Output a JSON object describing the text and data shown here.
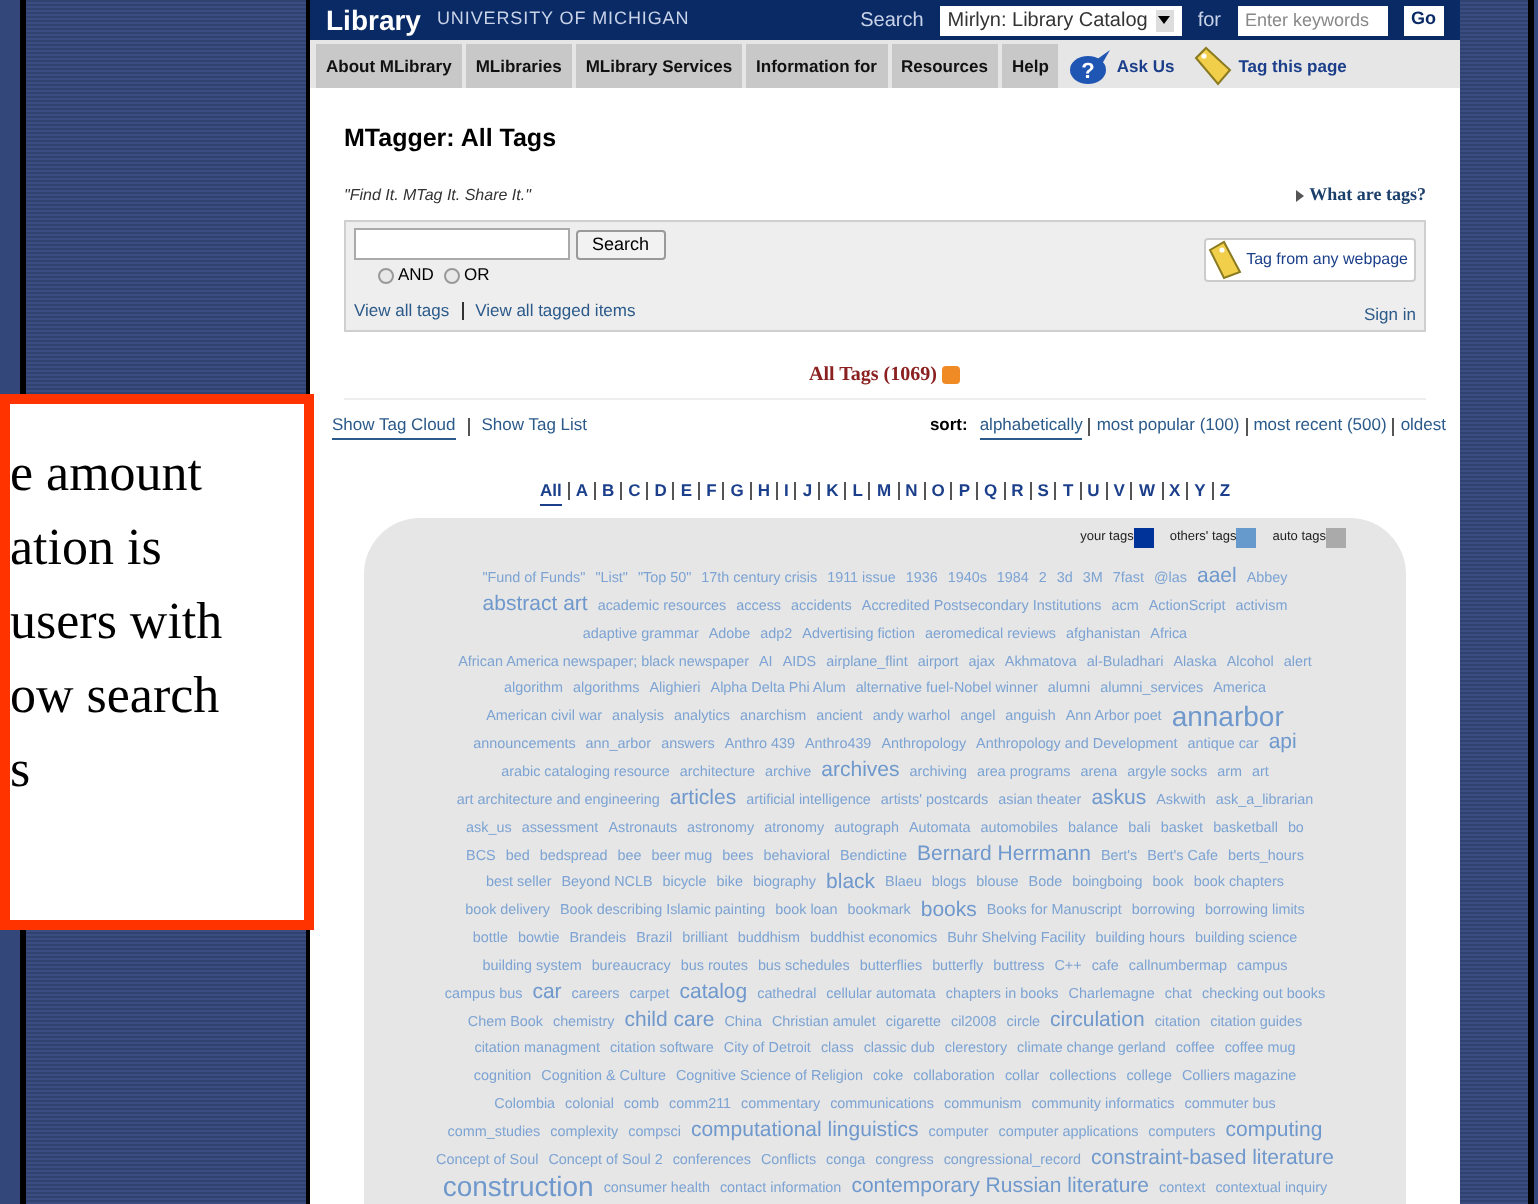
{
  "header": {
    "logo": "Library",
    "university": "UNIVERSITY OF MICHIGAN",
    "search_label": "Search",
    "catalog_select": "Mirlyn: Library Catalog",
    "for_label": "for",
    "keyword_placeholder": "Enter keywords",
    "go_button": "Go"
  },
  "nav": [
    {
      "label": "About MLibrary",
      "kind": "tab"
    },
    {
      "label": "MLibraries",
      "kind": "tab"
    },
    {
      "label": "MLibrary Services",
      "kind": "tab"
    },
    {
      "label": "Information for",
      "kind": "tab"
    },
    {
      "label": "Resources",
      "kind": "tab"
    },
    {
      "label": "Help",
      "kind": "tab"
    },
    {
      "label": "Ask Us",
      "kind": "ask",
      "icon_text": "?"
    },
    {
      "label": "Tag this page",
      "kind": "tag"
    }
  ],
  "page_title": "MTagger: All Tags",
  "tagline": "\"Find It. MTag It. Share It.\"",
  "what_are_tags": "What are tags?",
  "search": {
    "button": "Search",
    "options": [
      {
        "label": "AND",
        "selected": false
      },
      {
        "label": "OR",
        "selected": false
      }
    ],
    "links": [
      "View all tags",
      "View all tagged items"
    ],
    "sign_in": "Sign in",
    "tag_button": "Tag from any webpage"
  },
  "all_tags_heading": "All Tags (1069)",
  "view_links": [
    {
      "label": "Show Tag Cloud",
      "selected": true
    },
    {
      "label": "Show Tag List",
      "selected": false
    }
  ],
  "sort_label": "sort:",
  "sort_options": [
    {
      "label": "alphabetically",
      "selected": true
    },
    {
      "label": "most popular (100)",
      "selected": false
    },
    {
      "label": "most recent (500)",
      "selected": false
    },
    {
      "label": "oldest",
      "selected": false
    }
  ],
  "letters": [
    {
      "label": "All",
      "selected": true
    },
    {
      "label": "A",
      "selected": false
    },
    {
      "label": "B",
      "selected": false
    },
    {
      "label": "C",
      "selected": false
    },
    {
      "label": "D",
      "selected": false
    },
    {
      "label": "E",
      "selected": false
    },
    {
      "label": "F",
      "selected": false
    },
    {
      "label": "G",
      "selected": false
    },
    {
      "label": "H",
      "selected": false
    },
    {
      "label": "I",
      "selected": false
    },
    {
      "label": "J",
      "selected": false
    },
    {
      "label": "K",
      "selected": false
    },
    {
      "label": "L",
      "selected": false
    },
    {
      "label": "M",
      "selected": false
    },
    {
      "label": "N",
      "selected": false
    },
    {
      "label": "O",
      "selected": false
    },
    {
      "label": "P",
      "selected": false
    },
    {
      "label": "Q",
      "selected": false
    },
    {
      "label": "R",
      "selected": false
    },
    {
      "label": "S",
      "selected": false
    },
    {
      "label": "T",
      "selected": false
    },
    {
      "label": "U",
      "selected": false
    },
    {
      "label": "V",
      "selected": false
    },
    {
      "label": "W",
      "selected": false
    },
    {
      "label": "X",
      "selected": false
    },
    {
      "label": "Y",
      "selected": false
    },
    {
      "label": "Z",
      "selected": false
    }
  ],
  "legend": [
    {
      "label": "your tags",
      "color": "#003399"
    },
    {
      "label": "others' tags",
      "color": "#6699cc"
    },
    {
      "label": "auto tags",
      "color": "#aaaaaa"
    }
  ],
  "tag_rows": [
    [
      {
        "text": "\"Fund of Funds\"",
        "kind": "small"
      },
      {
        "text": "\"List\"",
        "kind": "small"
      },
      {
        "text": "\"Top 50\"",
        "kind": "small"
      },
      {
        "text": "17th century crisis",
        "kind": "small"
      },
      {
        "text": "1911 issue",
        "kind": "small"
      },
      {
        "text": "1936",
        "kind": "small"
      },
      {
        "text": "1940s",
        "kind": "small"
      },
      {
        "text": "1984",
        "kind": "small"
      },
      {
        "text": "2",
        "kind": "small"
      },
      {
        "text": "3d",
        "kind": "small"
      },
      {
        "text": "3M",
        "kind": "small"
      },
      {
        "text": "7fast",
        "kind": "small"
      },
      {
        "text": "@las",
        "kind": "small"
      },
      {
        "text": "aael",
        "kind": "medium"
      },
      {
        "text": "Abbey",
        "kind": "small"
      }
    ],
    [
      {
        "text": "abstract art",
        "kind": "medium"
      },
      {
        "text": "academic resources",
        "kind": "small"
      },
      {
        "text": "access",
        "kind": "small"
      },
      {
        "text": "accidents",
        "kind": "small"
      },
      {
        "text": "Accredited Postsecondary Institutions",
        "kind": "small"
      },
      {
        "text": "acm",
        "kind": "small"
      },
      {
        "text": "ActionScript",
        "kind": "small"
      },
      {
        "text": "activism",
        "kind": "small"
      }
    ],
    [
      {
        "text": "adaptive grammar",
        "kind": "small"
      },
      {
        "text": "Adobe",
        "kind": "small"
      },
      {
        "text": "adp2",
        "kind": "small"
      },
      {
        "text": "Advertising fiction",
        "kind": "small"
      },
      {
        "text": "aeromedical reviews",
        "kind": "small"
      },
      {
        "text": "afghanistan",
        "kind": "small"
      },
      {
        "text": "Africa",
        "kind": "small"
      }
    ],
    [
      {
        "text": "African America newspaper; black newspaper",
        "kind": "small"
      },
      {
        "text": "AI",
        "kind": "small"
      },
      {
        "text": "AIDS",
        "kind": "small"
      },
      {
        "text": "airplane_flint",
        "kind": "small"
      },
      {
        "text": "airport",
        "kind": "small"
      },
      {
        "text": "ajax",
        "kind": "small"
      },
      {
        "text": "Akhmatova",
        "kind": "small"
      },
      {
        "text": "al-Buladhari",
        "kind": "small"
      },
      {
        "text": "Alaska",
        "kind": "small"
      },
      {
        "text": "Alcohol",
        "kind": "small"
      },
      {
        "text": "alert",
        "kind": "small"
      }
    ],
    [
      {
        "text": "algorithm",
        "kind": "small"
      },
      {
        "text": "algorithms",
        "kind": "small"
      },
      {
        "text": "Alighieri",
        "kind": "small"
      },
      {
        "text": "Alpha Delta Phi Alum",
        "kind": "small"
      },
      {
        "text": "alternative fuel-Nobel winner",
        "kind": "small"
      },
      {
        "text": "alumni",
        "kind": "small"
      },
      {
        "text": "alumni_services",
        "kind": "small"
      },
      {
        "text": "America",
        "kind": "small"
      }
    ],
    [
      {
        "text": "American civil war",
        "kind": "small"
      },
      {
        "text": "analysis",
        "kind": "small"
      },
      {
        "text": "analytics",
        "kind": "small"
      },
      {
        "text": "anarchism",
        "kind": "small"
      },
      {
        "text": "ancient",
        "kind": "small"
      },
      {
        "text": "andy warhol",
        "kind": "small"
      },
      {
        "text": "angel",
        "kind": "small"
      },
      {
        "text": "anguish",
        "kind": "small"
      },
      {
        "text": "Ann Arbor poet",
        "kind": "small"
      },
      {
        "text": "annarbor",
        "kind": "large"
      }
    ],
    [
      {
        "text": "announcements",
        "kind": "small"
      },
      {
        "text": "ann_arbor",
        "kind": "small"
      },
      {
        "text": "answers",
        "kind": "small"
      },
      {
        "text": "Anthro 439",
        "kind": "small"
      },
      {
        "text": "Anthro439",
        "kind": "small"
      },
      {
        "text": "Anthropology",
        "kind": "small"
      },
      {
        "text": "Anthropology and Development",
        "kind": "small"
      },
      {
        "text": "antique car",
        "kind": "small"
      },
      {
        "text": "api",
        "kind": "medium"
      }
    ],
    [
      {
        "text": "arabic cataloging resource",
        "kind": "small"
      },
      {
        "text": "architecture",
        "kind": "small"
      },
      {
        "text": "archive",
        "kind": "small"
      },
      {
        "text": "archives",
        "kind": "medium"
      },
      {
        "text": "archiving",
        "kind": "small"
      },
      {
        "text": "area programs",
        "kind": "small"
      },
      {
        "text": "arena",
        "kind": "small"
      },
      {
        "text": "argyle socks",
        "kind": "small"
      },
      {
        "text": "arm",
        "kind": "small"
      },
      {
        "text": "art",
        "kind": "small"
      }
    ],
    [
      {
        "text": "art architecture and engineering",
        "kind": "small"
      },
      {
        "text": "articles",
        "kind": "medium"
      },
      {
        "text": "artificial intelligence",
        "kind": "small"
      },
      {
        "text": "artists' postcards",
        "kind": "small"
      },
      {
        "text": "asian theater",
        "kind": "small"
      },
      {
        "text": "askus",
        "kind": "medium"
      },
      {
        "text": "Askwith",
        "kind": "small"
      },
      {
        "text": "ask_a_librarian",
        "kind": "small"
      }
    ],
    [
      {
        "text": "ask_us",
        "kind": "small"
      },
      {
        "text": "assessment",
        "kind": "small"
      },
      {
        "text": "Astronauts",
        "kind": "small"
      },
      {
        "text": "astronomy",
        "kind": "small"
      },
      {
        "text": "atronomy",
        "kind": "small"
      },
      {
        "text": "autograph",
        "kind": "small"
      },
      {
        "text": "Automata",
        "kind": "small"
      },
      {
        "text": "automobiles",
        "kind": "small"
      },
      {
        "text": "balance",
        "kind": "small"
      },
      {
        "text": "bali",
        "kind": "small"
      },
      {
        "text": "basket",
        "kind": "small"
      },
      {
        "text": "basketball",
        "kind": "small"
      },
      {
        "text": "bo",
        "kind": "small"
      }
    ],
    [
      {
        "text": "BCS",
        "kind": "small"
      },
      {
        "text": "bed",
        "kind": "small"
      },
      {
        "text": "bedspread",
        "kind": "small"
      },
      {
        "text": "bee",
        "kind": "small"
      },
      {
        "text": "beer mug",
        "kind": "small"
      },
      {
        "text": "bees",
        "kind": "small"
      },
      {
        "text": "behavioral",
        "kind": "small"
      },
      {
        "text": "Bendictine",
        "kind": "small"
      },
      {
        "text": "Bernard Herrmann",
        "kind": "medium"
      },
      {
        "text": "Bert's",
        "kind": "small"
      },
      {
        "text": "Bert's Cafe",
        "kind": "small"
      },
      {
        "text": "berts_hours",
        "kind": "small"
      }
    ],
    [
      {
        "text": "best seller",
        "kind": "small"
      },
      {
        "text": "Beyond NCLB",
        "kind": "small"
      },
      {
        "text": "bicycle",
        "kind": "small"
      },
      {
        "text": "bike",
        "kind": "small"
      },
      {
        "text": "biography",
        "kind": "small"
      },
      {
        "text": "black",
        "kind": "medium"
      },
      {
        "text": "Blaeu",
        "kind": "small"
      },
      {
        "text": "blogs",
        "kind": "small"
      },
      {
        "text": "blouse",
        "kind": "small"
      },
      {
        "text": "Bode",
        "kind": "small"
      },
      {
        "text": "boingboing",
        "kind": "small"
      },
      {
        "text": "book",
        "kind": "small"
      },
      {
        "text": "book chapters",
        "kind": "small"
      }
    ],
    [
      {
        "text": "book delivery",
        "kind": "small"
      },
      {
        "text": "Book describing Islamic painting",
        "kind": "small"
      },
      {
        "text": "book loan",
        "kind": "small"
      },
      {
        "text": "bookmark",
        "kind": "small"
      },
      {
        "text": "books",
        "kind": "medium"
      },
      {
        "text": "Books for Manuscript",
        "kind": "small"
      },
      {
        "text": "borrowing",
        "kind": "small"
      },
      {
        "text": "borrowing limits",
        "kind": "small"
      }
    ],
    [
      {
        "text": "bottle",
        "kind": "small"
      },
      {
        "text": "bowtie",
        "kind": "small"
      },
      {
        "text": "Brandeis",
        "kind": "small"
      },
      {
        "text": "Brazil",
        "kind": "small"
      },
      {
        "text": "brilliant",
        "kind": "small"
      },
      {
        "text": "buddhism",
        "kind": "small"
      },
      {
        "text": "buddhist economics",
        "kind": "small"
      },
      {
        "text": "Buhr Shelving Facility",
        "kind": "small"
      },
      {
        "text": "building hours",
        "kind": "small"
      },
      {
        "text": "building science",
        "kind": "small"
      }
    ],
    [
      {
        "text": "building system",
        "kind": "small"
      },
      {
        "text": "bureaucracy",
        "kind": "small"
      },
      {
        "text": "bus routes",
        "kind": "small"
      },
      {
        "text": "bus schedules",
        "kind": "small"
      },
      {
        "text": "butterflies",
        "kind": "small"
      },
      {
        "text": "butterfly",
        "kind": "small"
      },
      {
        "text": "buttress",
        "kind": "small"
      },
      {
        "text": "C++",
        "kind": "small"
      },
      {
        "text": "cafe",
        "kind": "small"
      },
      {
        "text": "callnumbermap",
        "kind": "small"
      },
      {
        "text": "campus",
        "kind": "small"
      }
    ],
    [
      {
        "text": "campus bus",
        "kind": "small"
      },
      {
        "text": "car",
        "kind": "medium"
      },
      {
        "text": "careers",
        "kind": "small"
      },
      {
        "text": "carpet",
        "kind": "small"
      },
      {
        "text": "catalog",
        "kind": "medium"
      },
      {
        "text": "cathedral",
        "kind": "small"
      },
      {
        "text": "cellular automata",
        "kind": "small"
      },
      {
        "text": "chapters in books",
        "kind": "small"
      },
      {
        "text": "Charlemagne",
        "kind": "small"
      },
      {
        "text": "chat",
        "kind": "small"
      },
      {
        "text": "checking out books",
        "kind": "small"
      }
    ],
    [
      {
        "text": "Chem Book",
        "kind": "small"
      },
      {
        "text": "chemistry",
        "kind": "small"
      },
      {
        "text": "child care",
        "kind": "medium"
      },
      {
        "text": "China",
        "kind": "small"
      },
      {
        "text": "Christian amulet",
        "kind": "small"
      },
      {
        "text": "cigarette",
        "kind": "small"
      },
      {
        "text": "cil2008",
        "kind": "small"
      },
      {
        "text": "circle",
        "kind": "small"
      },
      {
        "text": "circulation",
        "kind": "medium"
      },
      {
        "text": "citation",
        "kind": "small"
      },
      {
        "text": "citation guides",
        "kind": "small"
      }
    ],
    [
      {
        "text": "citation managment",
        "kind": "small"
      },
      {
        "text": "citation software",
        "kind": "small"
      },
      {
        "text": "City of Detroit",
        "kind": "small"
      },
      {
        "text": "class",
        "kind": "small"
      },
      {
        "text": "classic dub",
        "kind": "small"
      },
      {
        "text": "clerestory",
        "kind": "small"
      },
      {
        "text": "climate change gerland",
        "kind": "small"
      },
      {
        "text": "coffee",
        "kind": "small"
      },
      {
        "text": "coffee mug",
        "kind": "small"
      }
    ],
    [
      {
        "text": "cognition",
        "kind": "small"
      },
      {
        "text": "Cognition & Culture",
        "kind": "small"
      },
      {
        "text": "Cognitive Science of Religion",
        "kind": "small"
      },
      {
        "text": "coke",
        "kind": "small"
      },
      {
        "text": "collaboration",
        "kind": "small"
      },
      {
        "text": "collar",
        "kind": "small"
      },
      {
        "text": "collections",
        "kind": "small"
      },
      {
        "text": "college",
        "kind": "small"
      },
      {
        "text": "Colliers magazine",
        "kind": "small"
      }
    ],
    [
      {
        "text": "Colombia",
        "kind": "small"
      },
      {
        "text": "colonial",
        "kind": "small"
      },
      {
        "text": "comb",
        "kind": "small"
      },
      {
        "text": "comm211",
        "kind": "small"
      },
      {
        "text": "commentary",
        "kind": "small"
      },
      {
        "text": "communications",
        "kind": "small"
      },
      {
        "text": "communism",
        "kind": "small"
      },
      {
        "text": "community informatics",
        "kind": "small"
      },
      {
        "text": "commuter bus",
        "kind": "small"
      }
    ],
    [
      {
        "text": "comm_studies",
        "kind": "small"
      },
      {
        "text": "complexity",
        "kind": "small"
      },
      {
        "text": "compsci",
        "kind": "small"
      },
      {
        "text": "computational linguistics",
        "kind": "medium"
      },
      {
        "text": "computer",
        "kind": "small"
      },
      {
        "text": "computer applications",
        "kind": "small"
      },
      {
        "text": "computers",
        "kind": "small"
      },
      {
        "text": "computing",
        "kind": "medium"
      }
    ],
    [
      {
        "text": "Concept of Soul",
        "kind": "small"
      },
      {
        "text": "Concept of Soul 2",
        "kind": "small"
      },
      {
        "text": "conferences",
        "kind": "small"
      },
      {
        "text": "Conflicts",
        "kind": "small"
      },
      {
        "text": "conga",
        "kind": "small"
      },
      {
        "text": "congress",
        "kind": "small"
      },
      {
        "text": "congressional_record",
        "kind": "small"
      },
      {
        "text": "constraint-based literature",
        "kind": "medium"
      }
    ],
    [
      {
        "text": "construction",
        "kind": "large"
      },
      {
        "text": "consumer health",
        "kind": "small"
      },
      {
        "text": "contact information",
        "kind": "small"
      },
      {
        "text": "contemporary Russian literature",
        "kind": "medium"
      },
      {
        "text": "context",
        "kind": "small"
      },
      {
        "text": "contextual inquiry",
        "kind": "small"
      }
    ]
  ],
  "callout": {
    "lines": [
      "e amount",
      "ation is",
      "users with",
      "ow search",
      "s"
    ]
  }
}
